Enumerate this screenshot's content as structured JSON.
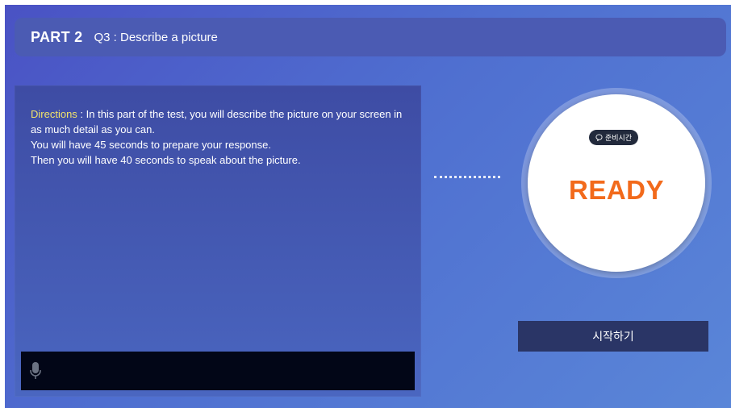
{
  "header": {
    "part": "PART 2",
    "question": "Q3 : Describe a picture"
  },
  "directions": {
    "label": "Directions",
    "separator": " : ",
    "lines": [
      "In this part of the test, you will describe the picture on your screen in as much detail as you can.",
      "You will have 45 seconds to prepare your response.",
      "Then you will have 40 seconds to speak about the picture."
    ]
  },
  "mic": {
    "icon": "microphone-icon"
  },
  "timer": {
    "badge_icon": "speech-bubble-icon",
    "badge_label": "준비시간",
    "status": "READY",
    "status_color": "#f26a1b"
  },
  "actions": {
    "start_label": "시작하기"
  }
}
